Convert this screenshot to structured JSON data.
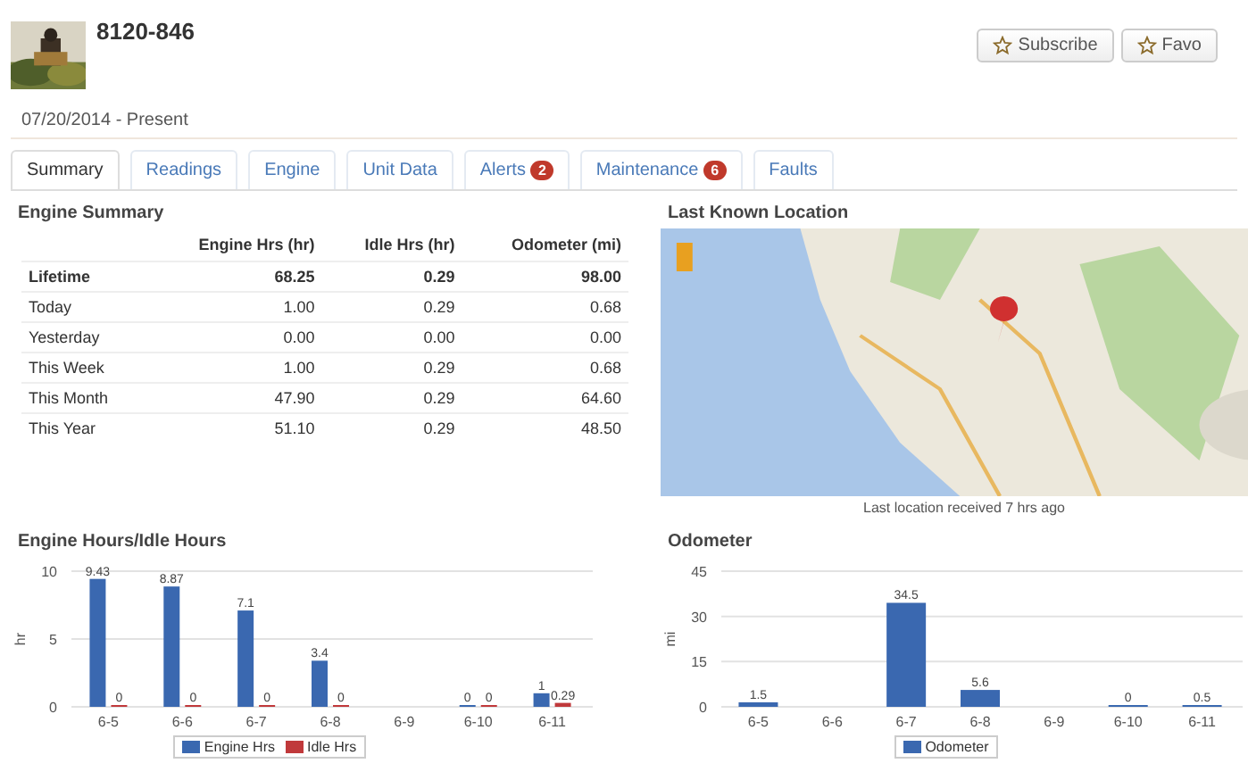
{
  "header": {
    "title": "8120-846",
    "buttons": [
      {
        "label": "Subscribe"
      },
      {
        "label": "Favo"
      }
    ]
  },
  "date_range": "07/20/2014 - Present",
  "tabs": [
    {
      "label": "Summary",
      "selected": true
    },
    {
      "label": "Readings",
      "selected": false
    },
    {
      "label": "Engine",
      "selected": false
    },
    {
      "label": "Unit Data",
      "selected": false
    },
    {
      "label": "Alerts",
      "selected": false,
      "badge": "2"
    },
    {
      "label": "Maintenance",
      "selected": false,
      "badge": "6"
    },
    {
      "label": "Faults",
      "selected": false
    }
  ],
  "engine_summary": {
    "title": "Engine Summary",
    "columns": [
      "",
      "Engine Hrs (hr)",
      "Idle Hrs (hr)",
      "Odometer (mi)"
    ],
    "rows": [
      {
        "cells": [
          "Lifetime",
          "68.25",
          "0.29",
          "98.00"
        ],
        "bold": true
      },
      {
        "cells": [
          "Today",
          "1.00",
          "0.29",
          "0.68"
        ],
        "bold": false
      },
      {
        "cells": [
          "Yesterday",
          "0.00",
          "0.00",
          "0.00"
        ],
        "bold": false
      },
      {
        "cells": [
          "This Week",
          "1.00",
          "0.29",
          "0.68"
        ],
        "bold": false
      },
      {
        "cells": [
          "This Month",
          "47.90",
          "0.29",
          "64.60"
        ],
        "bold": false
      },
      {
        "cells": [
          "This Year",
          "51.10",
          "0.29",
          "48.50"
        ],
        "bold": false
      }
    ]
  },
  "location": {
    "title": "Last Known Location",
    "caption": "Last location received 7 hrs ago"
  },
  "charts": [
    {
      "title": "Engine Hours/Idle Hours",
      "chart_data": {
        "type": "bar",
        "ylabel": "hr",
        "categories": [
          "6-5",
          "6-6",
          "6-7",
          "6-8",
          "6-9",
          "6-10",
          "6-11"
        ],
        "ylim": [
          0,
          10
        ],
        "yticks": [
          0,
          5,
          10
        ],
        "data_labels": true,
        "series": [
          {
            "name": "Engine Hrs",
            "color": "#3a68b0",
            "values": [
              9.43,
              8.87,
              7.1,
              3.4,
              null,
              0,
              1
            ]
          },
          {
            "name": "Idle Hrs",
            "color": "#c0393b",
            "values": [
              0,
              0,
              0,
              0,
              null,
              0,
              0.29
            ]
          }
        ]
      }
    },
    {
      "title": "Odometer",
      "chart_data": {
        "type": "bar",
        "ylabel": "mi",
        "categories": [
          "6-5",
          "6-6",
          "6-7",
          "6-8",
          "6-9",
          "6-10",
          "6-11"
        ],
        "ylim": [
          0,
          45
        ],
        "yticks": [
          0,
          15,
          30,
          45
        ],
        "data_labels": true,
        "series": [
          {
            "name": "Odometer",
            "color": "#3a68b0",
            "values": [
              1.5,
              null,
              34.5,
              5.6,
              null,
              0,
              0.5
            ]
          }
        ]
      }
    }
  ]
}
